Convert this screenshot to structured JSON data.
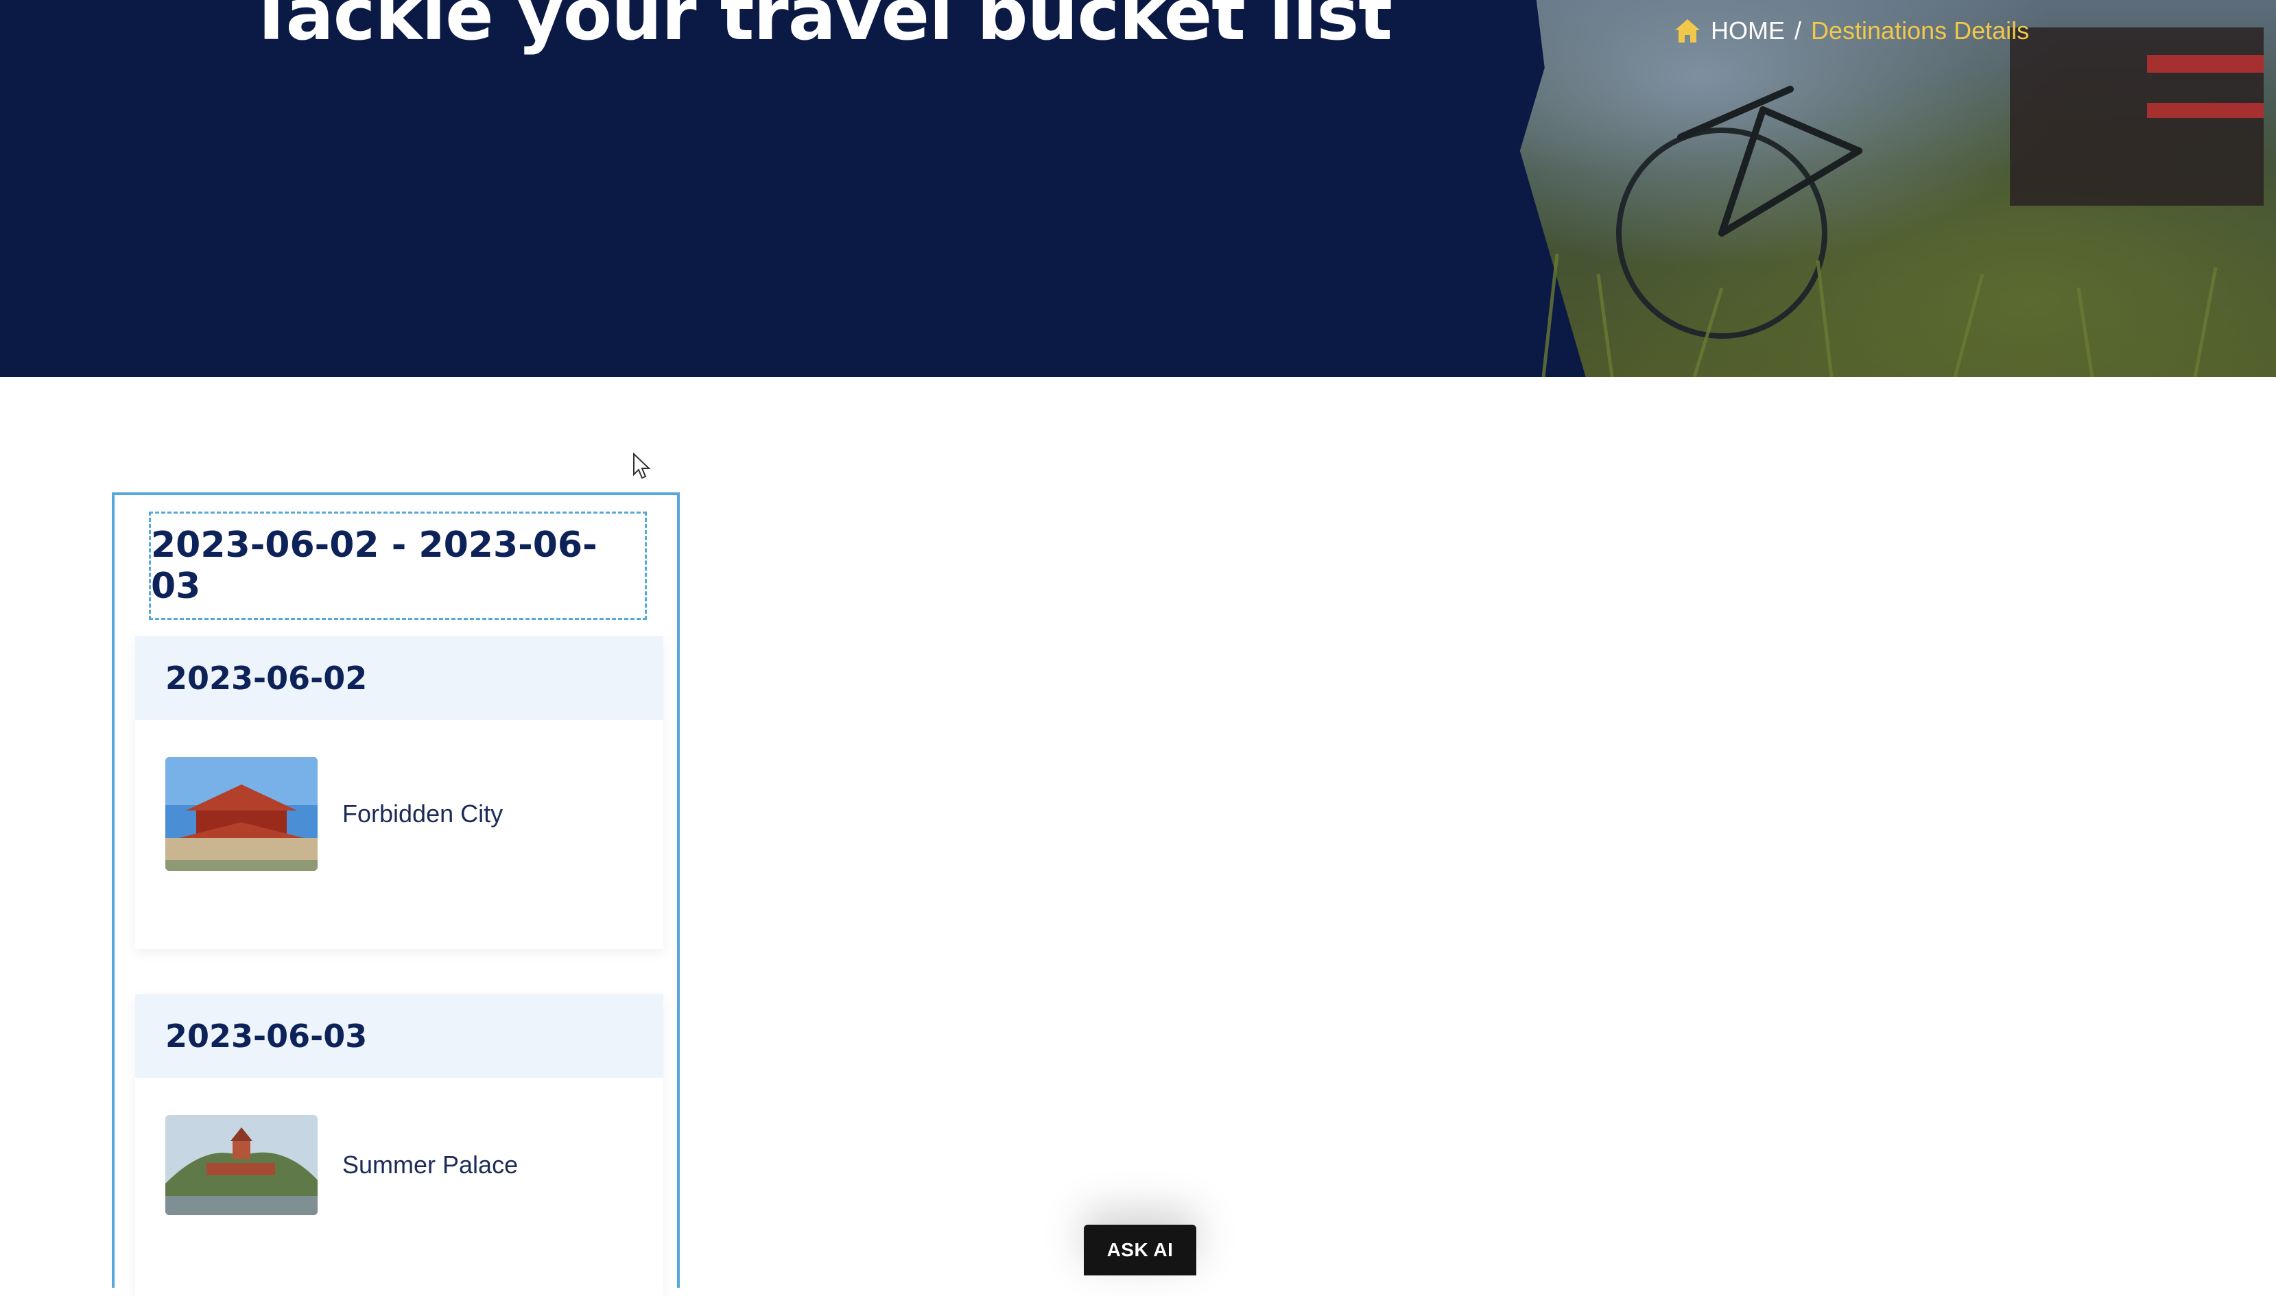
{
  "hero": {
    "title": "Tackle your travel bucket list",
    "background_color": "#0b1a45"
  },
  "breadcrumb": {
    "home_icon": "home-icon",
    "home_label": "HOME",
    "separator": "/",
    "current_label": "Destinations Details",
    "current_color": "#f2c84b"
  },
  "itinerary": {
    "range_label": "2023-06-02 - 2023-06-03",
    "border_color": "#56a8dc",
    "days": [
      {
        "date": "2023-06-02",
        "spots": [
          {
            "name": "Forbidden City",
            "image": "forbidden-city-photo"
          }
        ]
      },
      {
        "date": "2023-06-03",
        "spots": [
          {
            "name": "Summer Palace",
            "image": "summer-palace-photo"
          }
        ]
      }
    ]
  },
  "ask_ai": {
    "label": "ASK AI"
  }
}
